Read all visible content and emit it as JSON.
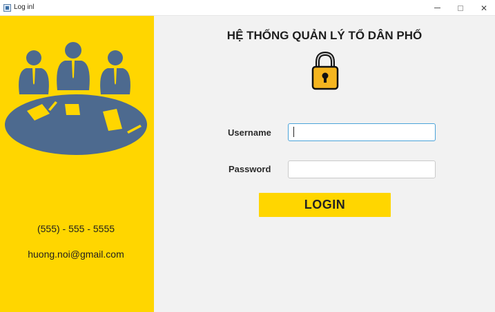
{
  "window": {
    "title": "Log inl",
    "icon": "java-app-icon",
    "controls": [
      "minimize-icon",
      "maximize-icon",
      "close-icon"
    ],
    "close_glyph": "✕"
  },
  "sidebar": {
    "background": "#ffd600",
    "illustration": "meeting-people-icon",
    "illustration_color": "#4d6a8f",
    "phone": "(555) - 555 - 5555",
    "email": "huong.noi@gmail.com"
  },
  "main": {
    "background": "#f2f2f2",
    "heading": "HỆ THỐNG QUẢN LÝ TỔ DÂN PHỐ",
    "lock_icon": "lock-icon",
    "username_label": "Username",
    "username_value": "",
    "password_label": "Password",
    "password_value": "",
    "login_label": "LOGIN",
    "accent": "#ffd600"
  }
}
